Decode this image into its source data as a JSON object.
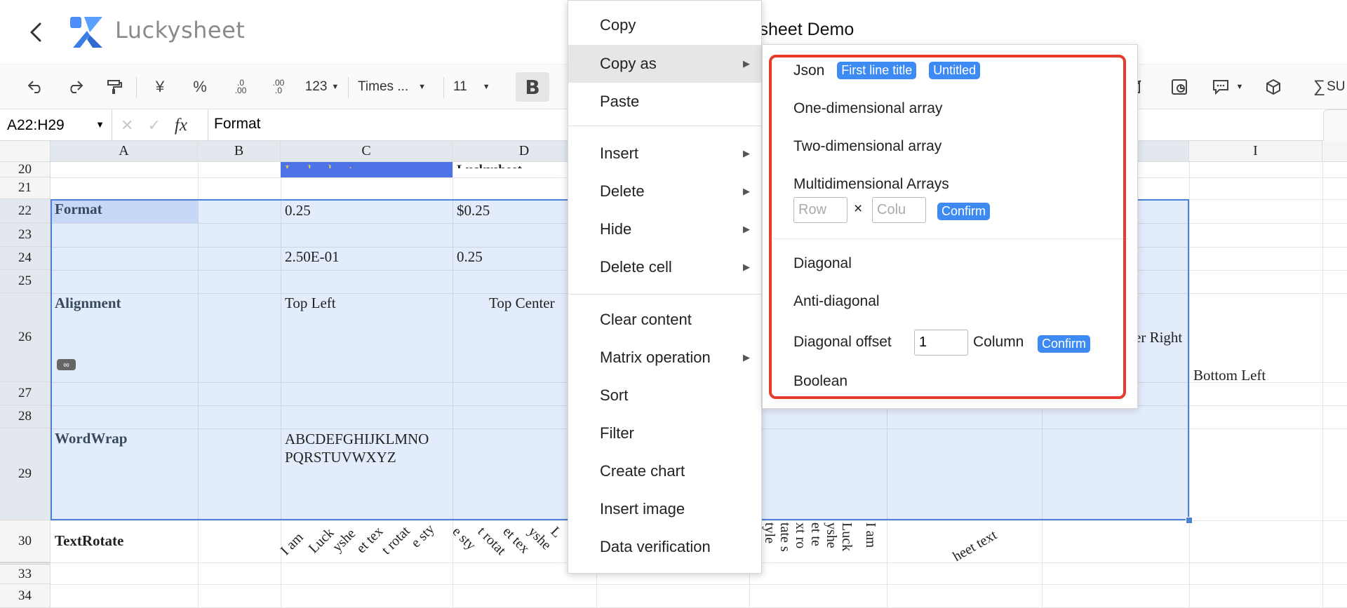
{
  "header": {
    "brand": "Luckysheet",
    "doc_title": "ysheet Demo"
  },
  "toolbar": {
    "currency": "¥",
    "percent": "%",
    "decrease_decimal": ".0 .00",
    "increase_decimal": ".00 .0",
    "number_format": "123",
    "font_family": "Times ...",
    "font_size": "11",
    "bold": "B",
    "sum_label": "SU"
  },
  "formula_bar": {
    "cell_ref": "A22:H29",
    "value": "Format"
  },
  "grid": {
    "columns": [
      "A",
      "B",
      "C",
      "D",
      "I"
    ],
    "rows": [
      "20",
      "21",
      "22",
      "23",
      "24",
      "25",
      "26",
      "27",
      "28",
      "29",
      "30",
      "33",
      "34"
    ],
    "cells": {
      "c20": "Luckysheet",
      "d20": "Luckysheet",
      "a22": "Format",
      "c22": "0.25",
      "d22": "$0.25",
      "c24": "2.50E-01",
      "d24": "0.25",
      "a26": "Alignment",
      "c26": "Top Left",
      "d26": "Top Center",
      "h26": "er Right",
      "i26": "Bottom Left",
      "a29": "WordWrap",
      "c29_line1": "ABCDEFGHIJKLMNO",
      "c29_line2": "PQRSTUVWXYZ",
      "a30": "TextRotate"
    },
    "rotated_c30": [
      "I am",
      "Luck",
      "yshe",
      "et tex",
      "t rotat",
      "e sty"
    ],
    "rotated_d30": [
      "e sty",
      "t rotat",
      "et tex",
      "yshe",
      "L"
    ],
    "vertical_f30": [
      "tyle",
      "tate s",
      "xt ro",
      "et te",
      "yshe",
      "Luck",
      "I am"
    ],
    "rotated_g30": "heet text"
  },
  "context_menu": {
    "items": [
      {
        "label": "Copy",
        "has_submenu": false
      },
      {
        "label": "Copy as",
        "has_submenu": true,
        "active": true
      },
      {
        "label": "Paste",
        "has_submenu": false
      },
      {
        "label": "Insert",
        "has_submenu": true
      },
      {
        "label": "Delete",
        "has_submenu": true
      },
      {
        "label": "Hide",
        "has_submenu": true
      },
      {
        "label": "Delete cell",
        "has_submenu": true
      },
      {
        "label": "Clear content",
        "has_submenu": false
      },
      {
        "label": "Matrix operation",
        "has_submenu": true
      },
      {
        "label": "Sort",
        "has_submenu": false
      },
      {
        "label": "Filter",
        "has_submenu": false
      },
      {
        "label": "Create chart",
        "has_submenu": false
      },
      {
        "label": "Insert image",
        "has_submenu": false
      },
      {
        "label": "Data verification",
        "has_submenu": false
      }
    ]
  },
  "copy_as_submenu": {
    "json": "Json",
    "first_line_title": "First line title",
    "untitled": "Untitled",
    "one_dim": "One-dimensional array",
    "two_dim": "Two-dimensional array",
    "multi_dim": "Multidimensional Arrays",
    "row_placeholder": "Row",
    "col_placeholder": "Colu",
    "times": "×",
    "confirm": "Confirm",
    "diagonal": "Diagonal",
    "anti_diagonal": "Anti-diagonal",
    "diagonal_offset": "Diagonal offset",
    "offset_value": "1",
    "column": "Column",
    "boolean": "Boolean"
  }
}
